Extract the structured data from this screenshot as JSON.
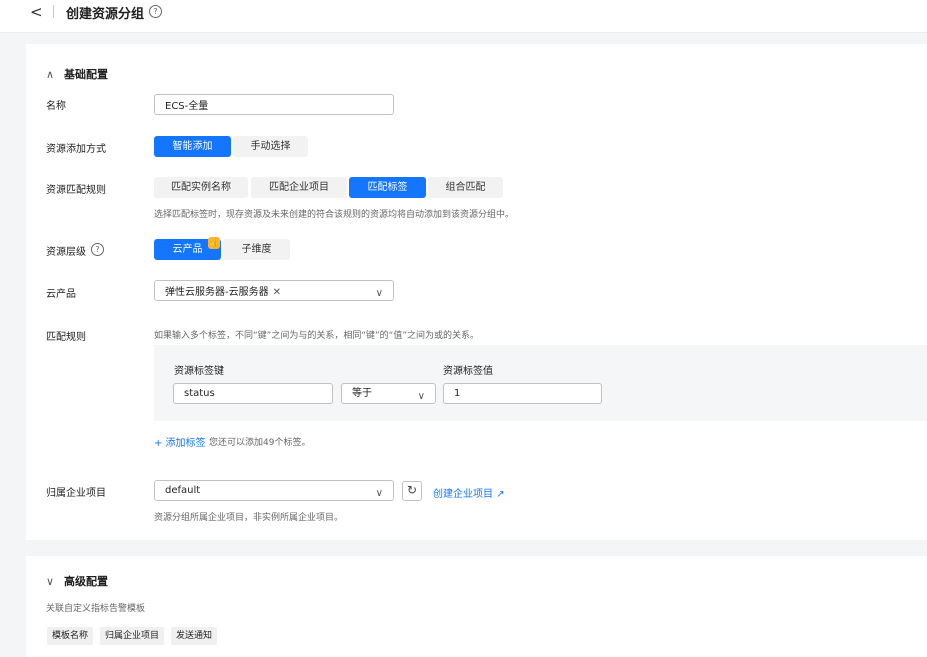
{
  "header": {
    "back_icon": "chevron-left-icon",
    "title": "创建资源分组",
    "help_icon": "question-circle-icon",
    "help_glyph": "?"
  },
  "basic": {
    "section_title": "基础配置",
    "collapse_icon": "chevron-up-icon",
    "collapse_glyph": "∧",
    "name": {
      "label": "名称",
      "value": "ECS-全量"
    },
    "add_method": {
      "label": "资源添加方式",
      "options": [
        "智能添加",
        "手动选择"
      ],
      "selected": "智能添加"
    },
    "match_rule": {
      "label": "资源匹配规则",
      "options": [
        "匹配实例名称",
        "匹配企业项目",
        "匹配标签",
        "组合匹配"
      ],
      "selected": "匹配标签",
      "hint": "选择匹配标签时，现存资源及未来创建的符合该规则的资源均将自动添加到该资源分组中。"
    },
    "level": {
      "label": "资源层级",
      "options": [
        "云产品",
        "子维度"
      ],
      "selected": "云产品",
      "badge_glyph": "👍"
    },
    "cloud_product": {
      "label": "云产品",
      "selected_tag": "弹性云服务器-云服务器",
      "remove_glyph": "✕",
      "dropdown_glyph": "∨"
    },
    "rules": {
      "label": "匹配规则",
      "hint": "如果输入多个标签，不同“键”之间为与的关系，相同“键”的“值”之间为或的关系。",
      "key_header": "资源标签键",
      "value_header": "资源标签值",
      "key_value": "status",
      "operator": "等于",
      "operator_glyph": "∨",
      "tag_value": "1",
      "add_tag_link": "+ 添加标签",
      "add_tag_hint": "您还可以添加49个标签。"
    },
    "enterprise": {
      "label": "归属企业项目",
      "value": "default",
      "dropdown_glyph": "∨",
      "refresh_icon": "refresh-icon",
      "refresh_glyph": "↻",
      "create_link": "创建企业项目",
      "external_icon": "external-link-icon",
      "external_glyph": "↗",
      "hint": "资源分组所属企业项目，非实例所属企业项目。"
    }
  },
  "advanced": {
    "section_title": "高级配置",
    "expand_icon": "chevron-down-icon",
    "expand_glyph": "∨",
    "subtitle": "关联自定义指标告警模板",
    "table_headers": [
      "模板名称",
      "归属企业项目",
      "发送通知"
    ]
  },
  "colors": {
    "accent": "#1476ff",
    "badge": "#ffb22e"
  }
}
